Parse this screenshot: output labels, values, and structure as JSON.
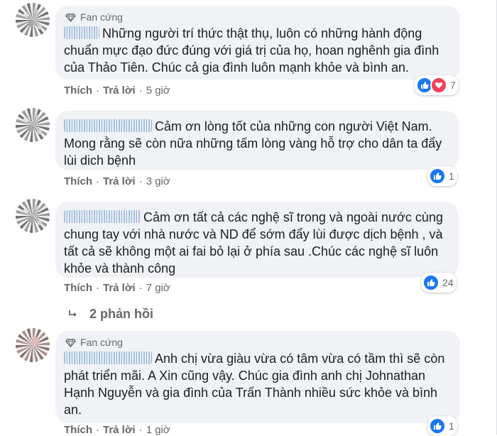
{
  "comments": [
    {
      "badge": "Fan cứng",
      "text": "Những người trí thức thật thụ, luôn có những hành động chuẩn mực đạo đức đúng với giá trị của họ, hoan nghênh gia đình của Thảo Tiên. Chúc cả gia đình luôn mạnh khỏe và bình an.",
      "reaction_count": "7",
      "like": "Thích",
      "reply": "Trả lời",
      "time": "5 giờ"
    },
    {
      "text": "Cảm ơn lòng tốt của những con người Việt Nam. Mong rằng sẽ còn nữa những tấm lòng vàng hỗ trợ cho dân ta đẩy lùi dich bệnh",
      "reaction_count": "1",
      "like": "Thích",
      "reply": "Trả lời",
      "time": "3 giờ"
    },
    {
      "text": "Cảm ơn tất cả các nghệ sĩ trong và ngoài nước cùng chung tay với nhà nước và ND để sớm đẩy lùi được dịch bệnh , và tất cả sẽ không một ai fai bỏ lại ở phía sau .Chúc các nghệ sĩ luôn khỏe và thành công",
      "reaction_count": "24",
      "like": "Thích",
      "reply": "Trả lời",
      "time": "7 giờ"
    },
    {
      "badge": "Fan cứng",
      "text": "Anh chị vừa giàu vừa có tâm vừa có tầm thì sẽ còn phát triển mãi. A Xin cũng vậy. Chúc gia đình anh chị Johnathan Hạnh Nguyễn và gia đình của Trấn Thành nhiều sức khỏe và bình an.",
      "reaction_count": "1",
      "like": "Thích",
      "reply": "Trả lời",
      "time": "1 giờ"
    }
  ],
  "replies_label": "2 phản hồi",
  "colors": {
    "bubble": "#f0f2f5",
    "like": "#1877f2",
    "love": "#f33e58",
    "meta": "#65676b"
  },
  "icons": [
    "diamond-icon",
    "like-reaction-icon",
    "love-reaction-icon",
    "reply-arrow-icon"
  ]
}
